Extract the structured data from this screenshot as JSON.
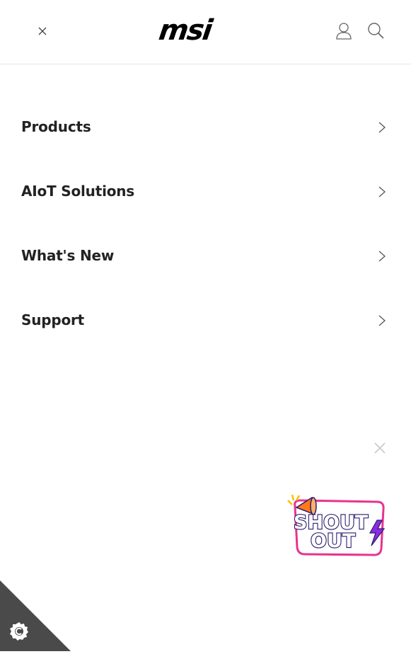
{
  "header": {
    "logo_text": "msi",
    "close_icon": "close-icon",
    "user_icon": "user-icon",
    "search_icon": "search-icon"
  },
  "menu": {
    "items": [
      {
        "label": "Products",
        "icon": "chevron-right-icon"
      },
      {
        "label": "AIoT Solutions",
        "icon": "chevron-right-icon"
      },
      {
        "label": "What's New",
        "icon": "chevron-right-icon"
      },
      {
        "label": "Support",
        "icon": "chevron-right-icon"
      }
    ]
  },
  "promo": {
    "line1": "SHOUT",
    "line2": "OUT",
    "icon": "megaphone-icon",
    "colors": {
      "pink": "#e8338f",
      "purple": "#8a2be2",
      "yellow": "#f5c400"
    }
  },
  "cookie": {
    "icon": "cookie-settings-icon",
    "color": "#4a4a4a"
  }
}
